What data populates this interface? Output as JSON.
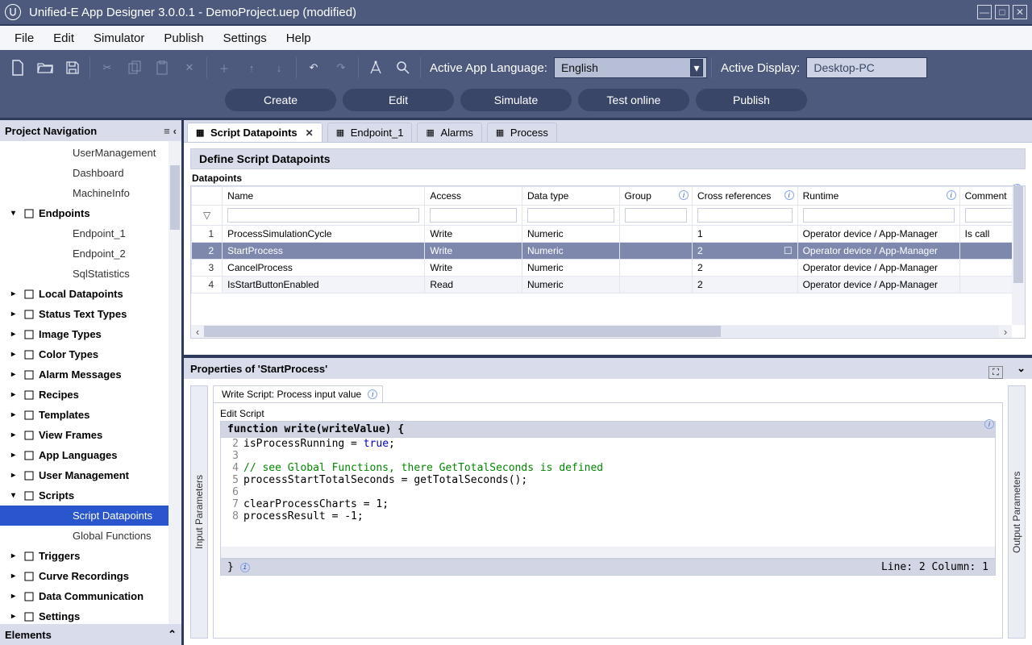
{
  "title": "Unified-E App Designer 3.0.0.1 - DemoProject.uep  (modified)",
  "menu": [
    "File",
    "Edit",
    "Simulator",
    "Publish",
    "Settings",
    "Help"
  ],
  "toolbar": {
    "lang_label": "Active App Language:",
    "lang_value": "English",
    "display_label": "Active Display:",
    "display_value": "Desktop-PC"
  },
  "actions": [
    "Create",
    "Edit",
    "Simulate",
    "Test online",
    "Publish"
  ],
  "nav": {
    "title": "Project Navigation",
    "top_items": [
      "UserManagement",
      "Dashboard",
      "MachineInfo"
    ],
    "endpoints": {
      "label": "Endpoints",
      "children": [
        "Endpoint_1",
        "Endpoint_2",
        "SqlStatistics"
      ]
    },
    "groups": [
      "Local Datapoints",
      "Status Text Types",
      "Image Types",
      "Color Types",
      "Alarm Messages",
      "Recipes",
      "Templates",
      "View Frames",
      "App Languages",
      "User Management"
    ],
    "scripts": {
      "label": "Scripts",
      "children": [
        "Script Datapoints",
        "Global Functions"
      ],
      "selected": "Script Datapoints"
    },
    "bottom_groups": [
      "Triggers",
      "Curve Recordings",
      "Data Communication",
      "Settings"
    ],
    "elements": "Elements"
  },
  "tabs": [
    "Script Datapoints",
    "Endpoint_1",
    "Alarms",
    "Process"
  ],
  "active_tab": 0,
  "section_title": "Define Script Datapoints",
  "grid_label": "Datapoints",
  "columns": [
    "",
    "Name",
    "Access",
    "Data type",
    "Group",
    "Cross references",
    "Runtime",
    "Comment"
  ],
  "rows": [
    {
      "n": 1,
      "name": "ProcessSimulationCycle",
      "access": "Write",
      "type": "Numeric",
      "group": "",
      "cross": "1",
      "runtime": "Operator device / App-Manager",
      "comment": "Is call"
    },
    {
      "n": 2,
      "name": "StartProcess",
      "access": "Write",
      "type": "Numeric",
      "group": "",
      "cross": "2",
      "runtime": "Operator device / App-Manager",
      "comment": ""
    },
    {
      "n": 3,
      "name": "CancelProcess",
      "access": "Write",
      "type": "Numeric",
      "group": "",
      "cross": "2",
      "runtime": "Operator device / App-Manager",
      "comment": ""
    },
    {
      "n": 4,
      "name": "IsStartButtonEnabled",
      "access": "Read",
      "type": "Numeric",
      "group": "",
      "cross": "2",
      "runtime": "Operator device / App-Manager",
      "comment": ""
    }
  ],
  "selected_row": 1,
  "props": {
    "title": "Properties of 'StartProcess'",
    "tab_label": "Write Script: Process input value",
    "fieldset": "Edit Script",
    "input_label": "Input Parameters",
    "output_label": "Output Parameters",
    "fn_header": "function write(writeValue) {",
    "lines": [
      {
        "n": 2,
        "html": "isProcessRunning = <span class='kw'>true</span>;"
      },
      {
        "n": 3,
        "html": ""
      },
      {
        "n": 4,
        "html": "<span class='cmt'>// see Global Functions, there GetTotalSeconds is defined</span>"
      },
      {
        "n": 5,
        "html": "processStartTotalSeconds = getTotalSeconds();"
      },
      {
        "n": 6,
        "html": ""
      },
      {
        "n": 7,
        "html": "clearProcessCharts = <span class='num2'>1</span>;"
      },
      {
        "n": 8,
        "html": "processResult = <span class='num2'>-1</span>;"
      }
    ],
    "fn_footer": "}",
    "status": "Line: 2   Column: 1"
  }
}
